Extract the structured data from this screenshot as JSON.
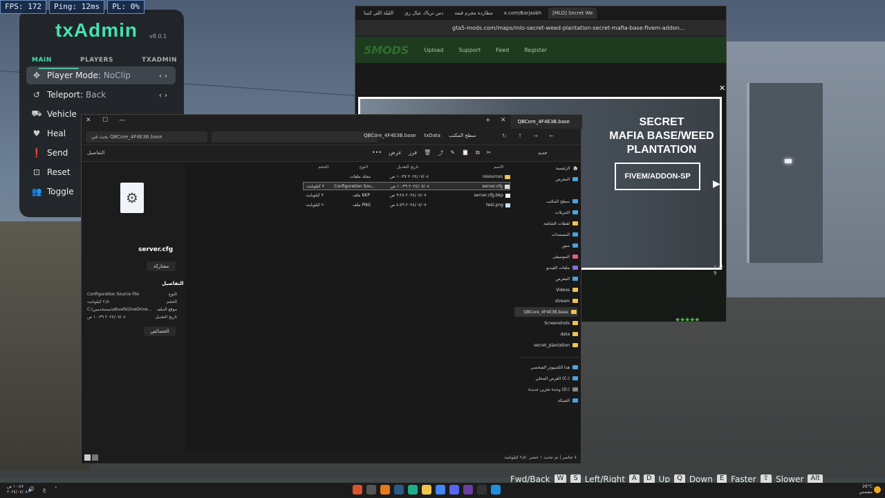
{
  "hud": {
    "fps": "FPS: 172",
    "ping": "Ping: 12ms",
    "pl": "PL: 0%"
  },
  "txadmin": {
    "logo": "txAdmin",
    "version": "v8.0.1",
    "tabs": [
      "MAIN",
      "PLAYERS",
      "TXADMIN"
    ],
    "items": [
      {
        "icon": "move-icon",
        "label": "Player Mode:",
        "value": "NoClip"
      },
      {
        "icon": "history-icon",
        "label": "Teleport:",
        "value": "Back"
      },
      {
        "icon": "car-icon",
        "label": "Vehicle",
        "value": ""
      },
      {
        "icon": "heart-icon",
        "label": "Heal",
        "value": ""
      },
      {
        "icon": "alert-icon",
        "label": "Send",
        "value": ""
      },
      {
        "icon": "reset-icon",
        "label": "Reset",
        "value": ""
      },
      {
        "icon": "users-icon",
        "label": "Toggle",
        "value": ""
      }
    ]
  },
  "browser": {
    "tabs": [
      "[MLO] Secret We",
      "x.com/Barjasbh",
      "مطاردة مجرم قبعه",
      "دس ترياك عيال ري",
      "الليلة اللي كتبنا"
    ],
    "url": "gta5-mods.com/maps/mlo-secret-weed-plantation-secret-mafia-base-fivem-addon...",
    "site_logo": "5MODS",
    "site_nav": [
      "Upload",
      "Support",
      "Feed",
      "Register"
    ],
    "promo_title_lines": [
      "SECRET",
      "MAFIA BASE/WEED",
      "PLANTATION"
    ],
    "promo_tag": "FIVEM/ADDON-SP",
    "promo_counter": "1 of 9"
  },
  "explorer": {
    "tab_title": "QBCore_4F4E3B.base",
    "search_placeholder": "بحث في QBCore_4F4E3B.base",
    "breadcrumbs": [
      "QBCore_4F4E3B.base",
      "txData",
      "سطح المكتب"
    ],
    "toolbar": {
      "new": "جديد",
      "sort": "فرز",
      "view": "عرض",
      "details": "التفاصيل"
    },
    "details": {
      "file_name": "server.cfg",
      "share": "مشاركة",
      "heading": "التفاصيل",
      "rows": [
        {
          "k": "النوع",
          "v": "Configuration Source File"
        },
        {
          "k": "الحجم",
          "v": "٢٫٥٠ كيلوبايت"
        },
        {
          "k": "موقع الملف",
          "v": "C:\\مستخدمين\\abuafs\\OneDrive..."
        },
        {
          "k": "تاريخ التعديل",
          "v": "٢٠٢٤/٠٧/٠٨ ١٠:٣٩ ص"
        }
      ],
      "properties": "الخصائص"
    },
    "columns": [
      "الاسم",
      "تاريخ التعديل",
      "النوع",
      "الحجم"
    ],
    "files": [
      {
        "name": "resources",
        "date": "٢٠٢٤/٠٧/٠٨ ١٠:٣٧ ص",
        "type": "مجلد ملفات",
        "size": "",
        "kind": "folder"
      },
      {
        "name": "server.cfg",
        "date": "٢٠٢٤/٠٧/٠٨ ١٠:٣٩ ص",
        "type": "Configuration Sou...",
        "size": "٣ كيلوبايت",
        "kind": "cfg",
        "selected": true
      },
      {
        "name": "server.cfg.bkp",
        "date": "٢٠٢٤/٠٧/٠٧ ٩:٢٨ ص",
        "type": "ملف BKP",
        "size": "٣ كيلوبايت",
        "kind": "file"
      },
      {
        "name": "test.png",
        "date": "٢٠٢٤/٠٧/٠٧ ٨:٤٩ ص",
        "type": "ملف PNG",
        "size": "٢٠ كيلوبايت",
        "kind": "image"
      }
    ],
    "nav": [
      {
        "label": "الرئيسية",
        "kind": "home"
      },
      {
        "label": "المعرض",
        "kind": "gallery"
      },
      {
        "label": "سطح المكتب",
        "kind": "blue",
        "pin": true
      },
      {
        "label": "التنزيلات",
        "kind": "blue",
        "pin": true
      },
      {
        "label": "لقطات الشاشة",
        "kind": "folder",
        "pin": true
      },
      {
        "label": "المستندات",
        "kind": "blue",
        "pin": true
      },
      {
        "label": "صور",
        "kind": "blue",
        "pin": true
      },
      {
        "label": "الموسيقى",
        "kind": "blue",
        "pin": true
      },
      {
        "label": "ملفات الفيديو",
        "kind": "blue",
        "pin": true
      },
      {
        "label": "المعرض",
        "kind": "blue",
        "pin": true
      },
      {
        "label": "Videos",
        "kind": "folder",
        "pin": true
      },
      {
        "label": "stream",
        "kind": "folder",
        "pin": true
      },
      {
        "label": "QBCore_4F4E3B.base",
        "kind": "folder",
        "pin": true,
        "selected": true
      },
      {
        "label": "Screenshots",
        "kind": "folder"
      },
      {
        "label": "data",
        "kind": "folder"
      },
      {
        "label": "secret_plantation",
        "kind": "folder"
      },
      {
        "label": "هذا الكمبيوتر الشخصي",
        "kind": "blue"
      },
      {
        "label": "القرص المحلي (C:)",
        "kind": "blue"
      },
      {
        "label": "وحدة تخزين جديدة (D:)",
        "kind": "blue"
      },
      {
        "label": "الشبكة",
        "kind": "blue"
      }
    ],
    "status": "٤ عناصر | تم تحديد ١ عنصر ٢٫٥٠ كيلوبايت"
  },
  "controls": [
    {
      "label": "Fwd/Back",
      "keys": [
        "W",
        "S"
      ]
    },
    {
      "label": "Left/Right",
      "keys": [
        "A",
        "D"
      ]
    },
    {
      "label": "Up",
      "keys": [
        "Q"
      ]
    },
    {
      "label": "Down",
      "keys": [
        "E"
      ]
    },
    {
      "label": "Faster",
      "keys": [
        "⇧"
      ]
    },
    {
      "label": "Slower",
      "keys": [
        "Alt"
      ]
    }
  ],
  "taskbar": {
    "time": "١٠:٤٧ ص",
    "date": "٢٠٢٤/٠٧/٠٨",
    "lang": "ع",
    "weather_temp": "26°C",
    "weather_desc": "مشمس"
  },
  "colors": {
    "txadmin_accent": "#45e0b3",
    "folder": "#f0c44c",
    "site_green": "#1f3b1f"
  }
}
